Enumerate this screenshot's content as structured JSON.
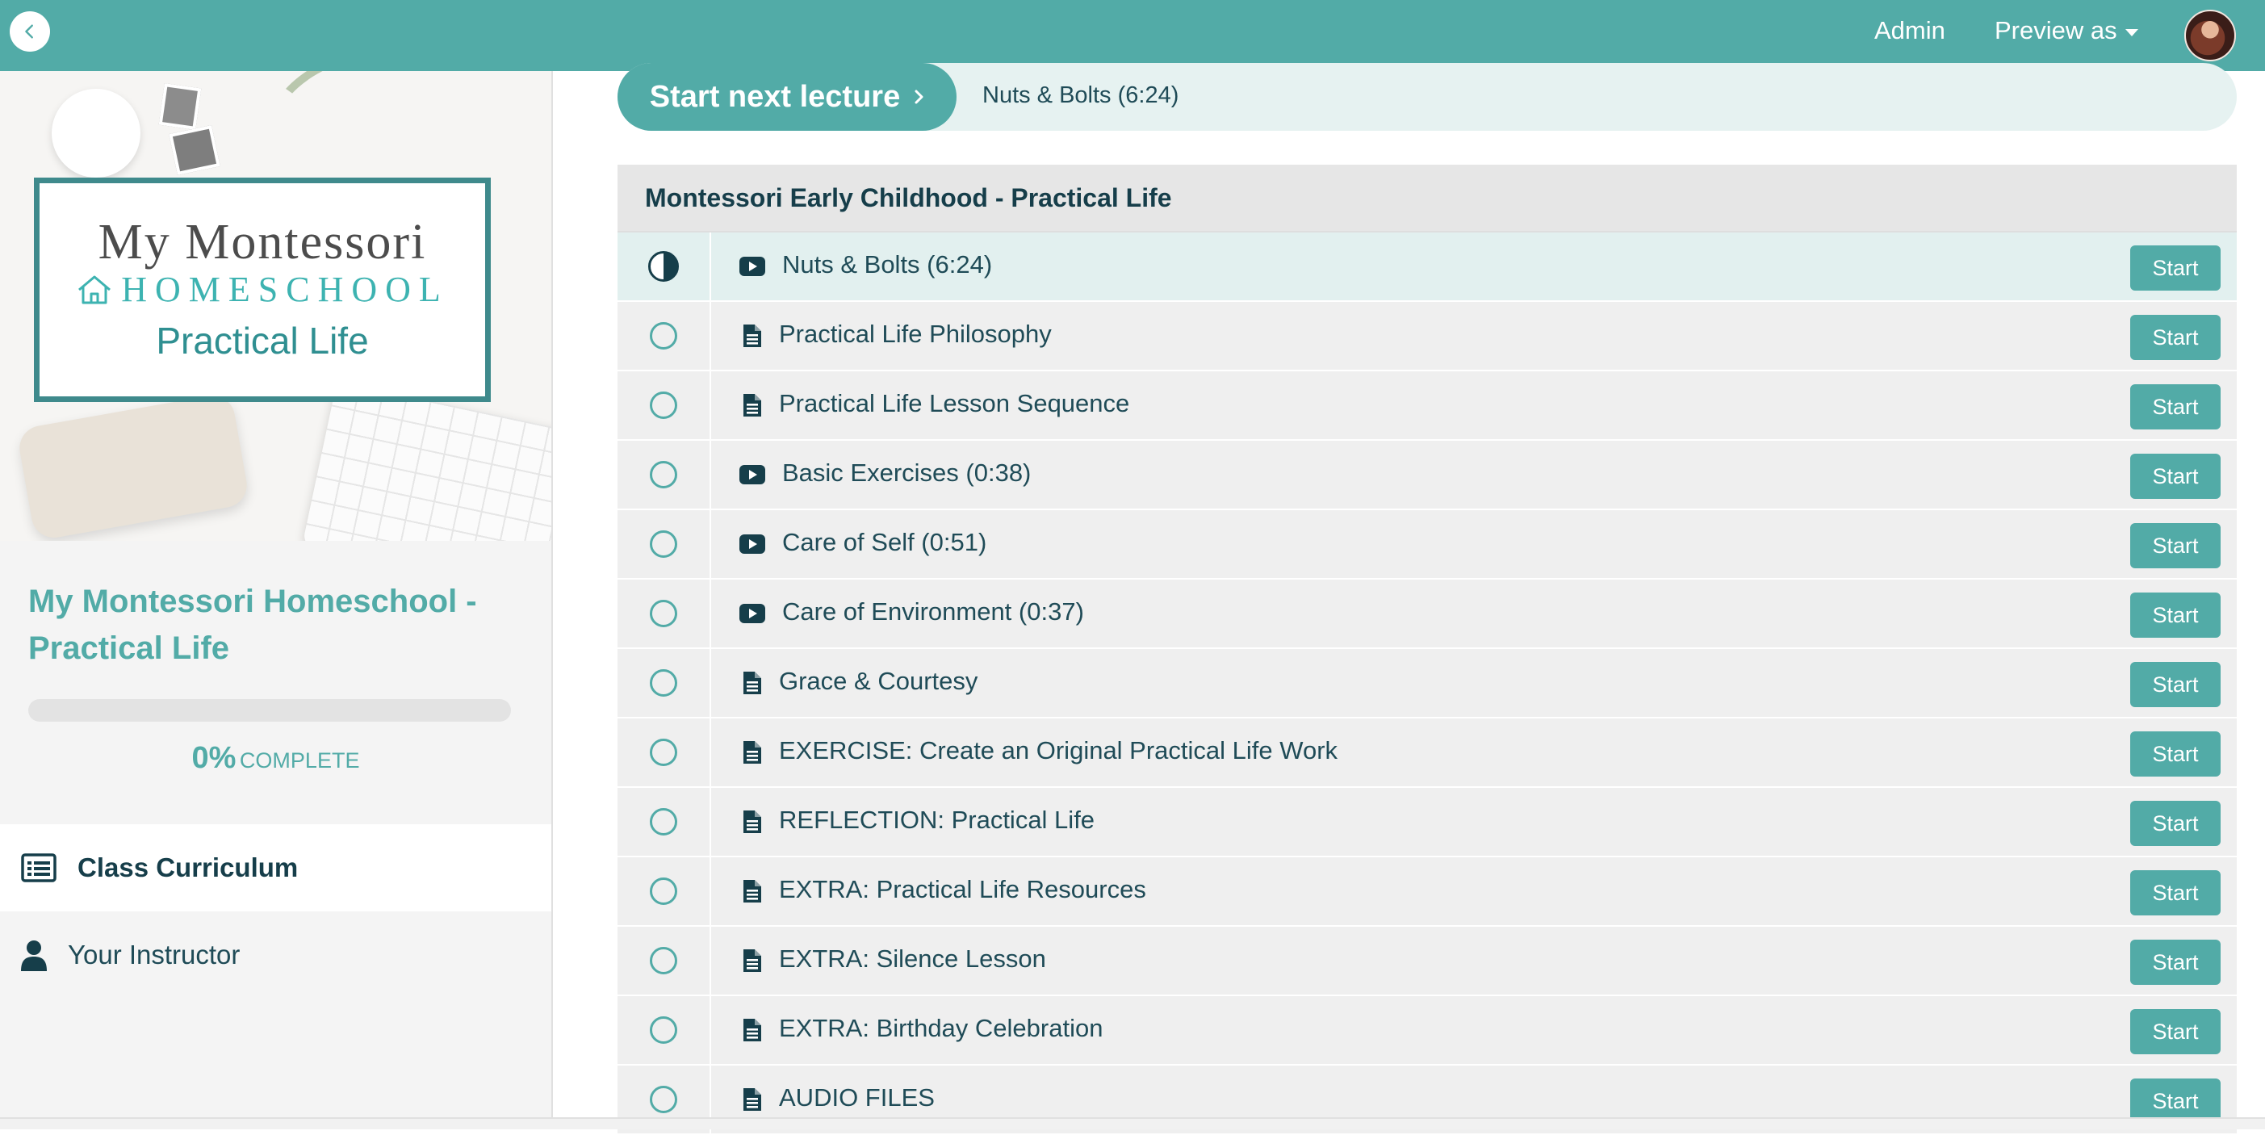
{
  "header": {
    "admin_label": "Admin",
    "preview_label": "Preview as"
  },
  "brand_color": "#52aba7",
  "sidebar": {
    "logo": {
      "line1": "My Montessori",
      "line2": "HOMESCHOOL",
      "line3": "Practical Life"
    },
    "course_title": "My Montessori Homeschool - Practical Life",
    "progress_value": 0,
    "progress_percent_text": "0%",
    "progress_label": "COMPLETE",
    "nav": [
      {
        "label": "Class Curriculum",
        "icon": "list-icon"
      },
      {
        "label": "Your Instructor",
        "icon": "user-icon"
      }
    ]
  },
  "main": {
    "start_next_label": "Start next lecture",
    "next_lecture_title": "Nuts & Bolts (6:24)",
    "section_title": "Montessori Early Childhood - Practical Life",
    "start_button_label": "Start",
    "lectures": [
      {
        "title": "Nuts & Bolts (6:24)",
        "type": "video",
        "status": "in-progress"
      },
      {
        "title": "Practical Life Philosophy",
        "type": "text",
        "status": "not-started"
      },
      {
        "title": "Practical Life Lesson Sequence",
        "type": "text",
        "status": "not-started"
      },
      {
        "title": "Basic Exercises (0:38)",
        "type": "video",
        "status": "not-started"
      },
      {
        "title": "Care of Self (0:51)",
        "type": "video",
        "status": "not-started"
      },
      {
        "title": "Care of Environment (0:37)",
        "type": "video",
        "status": "not-started"
      },
      {
        "title": "Grace & Courtesy",
        "type": "text",
        "status": "not-started"
      },
      {
        "title": "EXERCISE: Create an Original Practical Life Work",
        "type": "text",
        "status": "not-started"
      },
      {
        "title": "REFLECTION: Practical Life",
        "type": "text",
        "status": "not-started"
      },
      {
        "title": "EXTRA: Practical Life Resources",
        "type": "text",
        "status": "not-started"
      },
      {
        "title": "EXTRA: Silence Lesson",
        "type": "text",
        "status": "not-started"
      },
      {
        "title": "EXTRA: Birthday Celebration",
        "type": "text",
        "status": "not-started"
      },
      {
        "title": "AUDIO FILES",
        "type": "text",
        "status": "not-started"
      }
    ]
  }
}
